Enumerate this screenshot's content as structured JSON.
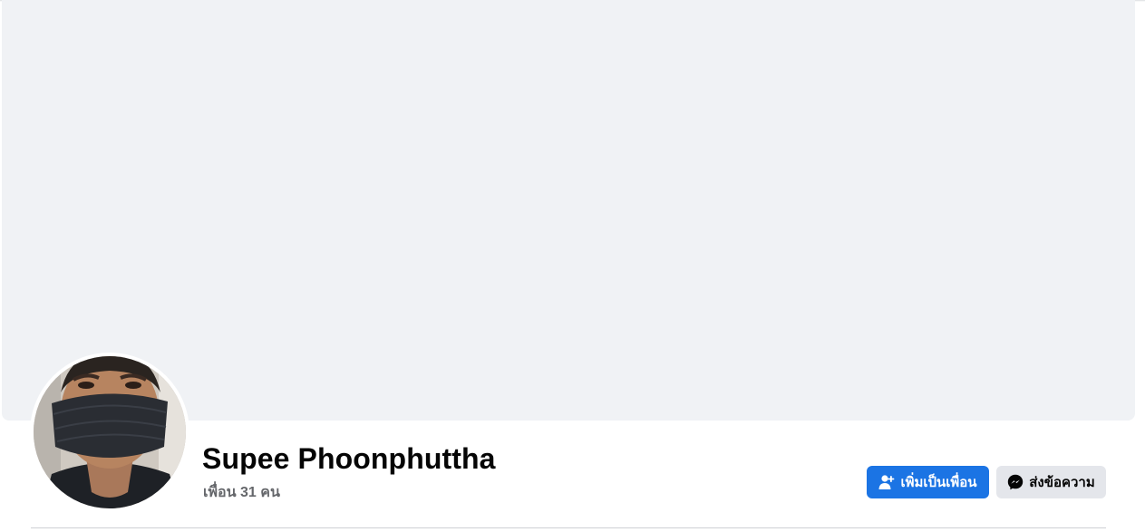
{
  "profile": {
    "name": "Supee Phoonphuttha",
    "friends_label": "เพื่อน 31 คน"
  },
  "actions": {
    "add_friend_label": "เพิ่มเป็นเพื่อน",
    "message_label": "ส่งข้อความ"
  },
  "icons": {
    "add_friend": "add-friend-icon",
    "messenger": "messenger-icon"
  },
  "colors": {
    "cover_bg": "#f0f2f5",
    "primary_button": "#1b74e4",
    "secondary_button": "#e4e6eb",
    "name_text": "#050505",
    "secondary_text": "#65676b"
  }
}
